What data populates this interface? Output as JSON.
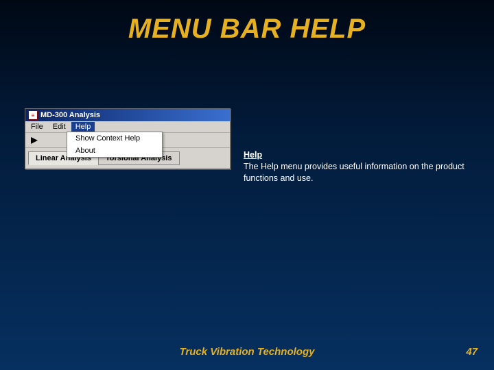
{
  "title": "MENU BAR HELP",
  "window": {
    "title": "MD-300 Analysis",
    "menu": {
      "items": [
        "File",
        "Edit",
        "Help"
      ],
      "active_index": 2,
      "dropdown": [
        "Show Context Help",
        "About"
      ]
    },
    "tabs": {
      "items": [
        "Linear Analysis",
        "Torsional Analysis"
      ],
      "active_index": 0
    }
  },
  "description": {
    "heading": "Help",
    "body": "The Help menu provides useful information on the product functions and use."
  },
  "footer": {
    "text": "Truck Vibration Technology",
    "page": "47"
  }
}
